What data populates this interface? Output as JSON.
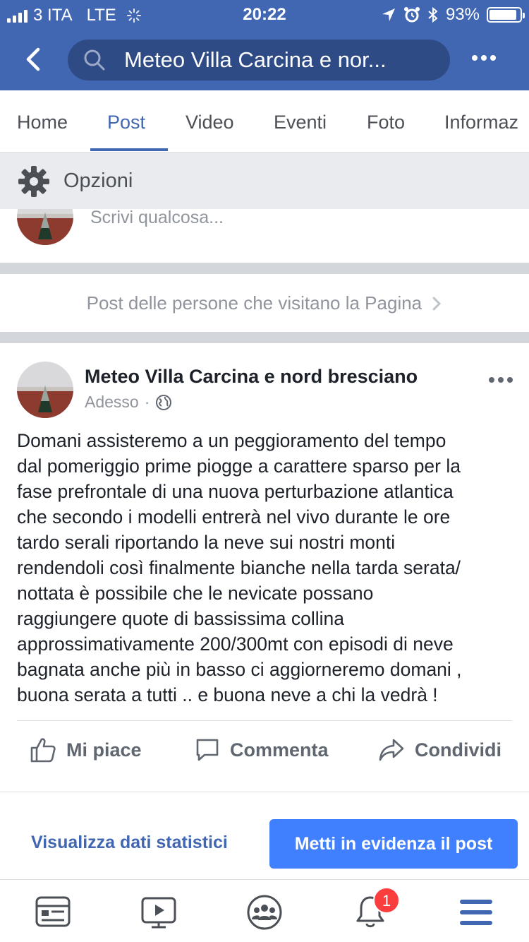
{
  "status_bar": {
    "carrier": "3 ITA",
    "network": "LTE",
    "time": "20:22",
    "battery": "93%"
  },
  "header": {
    "search_text": "Meteo Villa Carcina e nor..."
  },
  "tabs": [
    {
      "label": "Home"
    },
    {
      "label": "Post",
      "active": true
    },
    {
      "label": "Video"
    },
    {
      "label": "Eventi"
    },
    {
      "label": "Foto"
    },
    {
      "label": "Informaz"
    }
  ],
  "options": {
    "label": "Opzioni"
  },
  "composer": {
    "placeholder": "Scrivi qualcosa..."
  },
  "visitors_link": {
    "label": "Post delle persone che visitano la Pagina"
  },
  "post": {
    "author": "Meteo Villa Carcina e nord bresciano",
    "time": "Adesso",
    "separator": "·",
    "text": "Domani assisteremo a un peggioramento del tempo\ndal pomeriggio prime piogge a carattere sparso per la\nfase prefrontale di una nuova perturbazione atlantica\nche secondo i modelli entrerà nel vivo durante le ore\ntardo serali riportando la neve sui nostri monti\nrendendoli così finalmente bianche nella tarda serata/\nnottata è possibile che le nevicate possano\nraggiungere quote di bassissima collina\napprossimativamente 200/300mt con episodi di neve\nbagnata anche più in basso ci aggiorneremo domani ,\nbuona serata a tutti .. e buona neve a chi la vedrà !",
    "actions": {
      "like": "Mi piace",
      "comment": "Commenta",
      "share": "Condividi"
    }
  },
  "footer_actions": {
    "insights": "Visualizza dati statistici",
    "boost": "Metti in evidenza il post"
  },
  "bottom_bar": {
    "notifications_badge": "1"
  },
  "colors": {
    "brand_blue": "#4267b2",
    "boost_blue": "#4080ff",
    "badge_red": "#fa3e3e"
  }
}
